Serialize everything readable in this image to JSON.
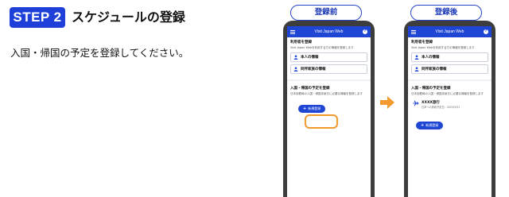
{
  "step": {
    "badge": "STEP 2",
    "title": "スケジュールの登録",
    "description": "入国・帰国の予定を登録してください。"
  },
  "before": {
    "caption": "登録前",
    "app_title": "Visit Japan Web",
    "user_section": {
      "heading": "利用者を登録",
      "desc": "Visit Japan Webを利用する方の情報を登録します",
      "self_label": "本人の情報",
      "family_label": "同伴家族の情報"
    },
    "schedule_section": {
      "heading": "入国・帰国の予定を登録",
      "desc": "日本到着時の入国・帰国手続きに必要な情報を登録します",
      "new_button": "新規登録"
    }
  },
  "after": {
    "caption": "登録後",
    "app_title": "Visit Japan Web",
    "user_section": {
      "heading": "利用者を登録",
      "desc": "Visit Japan Webを利用する方の情報を登録します",
      "self_label": "本人の情報",
      "family_label": "同伴家族の情報"
    },
    "schedule_section": {
      "heading": "入国・帰国の予定を登録",
      "desc": "日本到着時の入国・帰国手続きに必要な情報を登録します",
      "trip_name": "XXXX旅行",
      "trip_dates": "日本への到着予定日：2023/3/31",
      "new_button": "新規登録"
    }
  },
  "colors": {
    "brand_blue": "#1e45d4",
    "highlight_orange": "#f29a2e",
    "arrow_orange": "#f39a2e"
  },
  "icons": [
    "person-icon",
    "plane-icon",
    "plus-icon",
    "hamburger-icon",
    "help-icon",
    "right-arrow-icon"
  ]
}
